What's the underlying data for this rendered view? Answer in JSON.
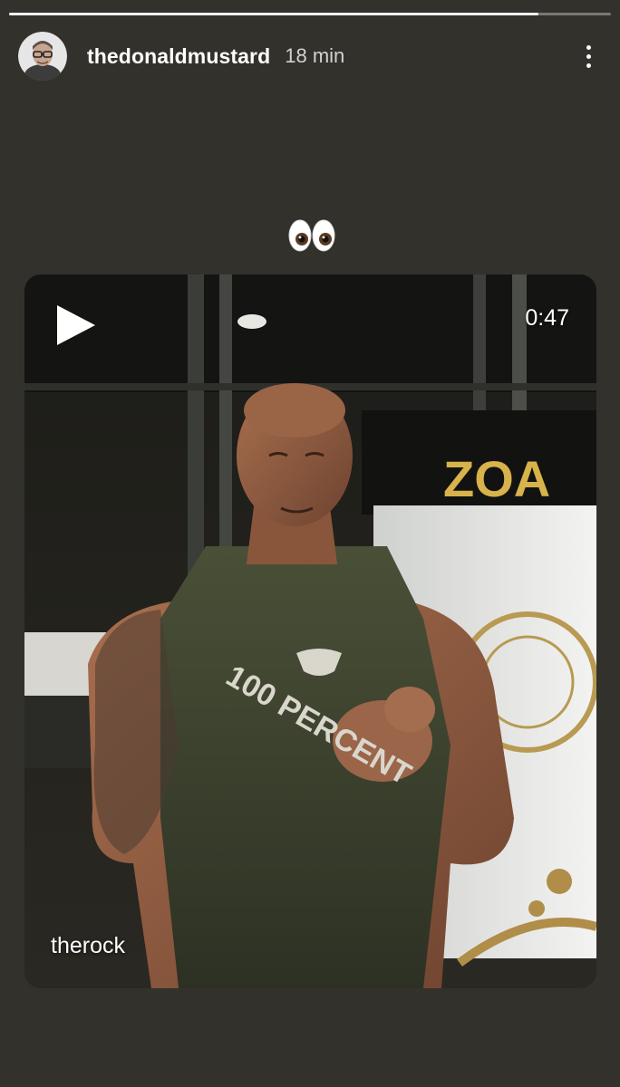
{
  "story": {
    "progress": 0.88,
    "author": {
      "username": "thedonaldmustard",
      "posted": "18 min"
    },
    "sticker_emoji": "eyes-emoji",
    "icons": {
      "more": "more-vertical-icon",
      "play": "play-icon"
    }
  },
  "video": {
    "duration": "0:47",
    "author": "therock",
    "shirt_text": "100 PERCENT",
    "sign_text": "ZOA"
  },
  "colors": {
    "background": "#33312b",
    "progress_fill": "#f4f4f4",
    "text": "#ffffff",
    "sign_gold": "#d8b24a"
  }
}
